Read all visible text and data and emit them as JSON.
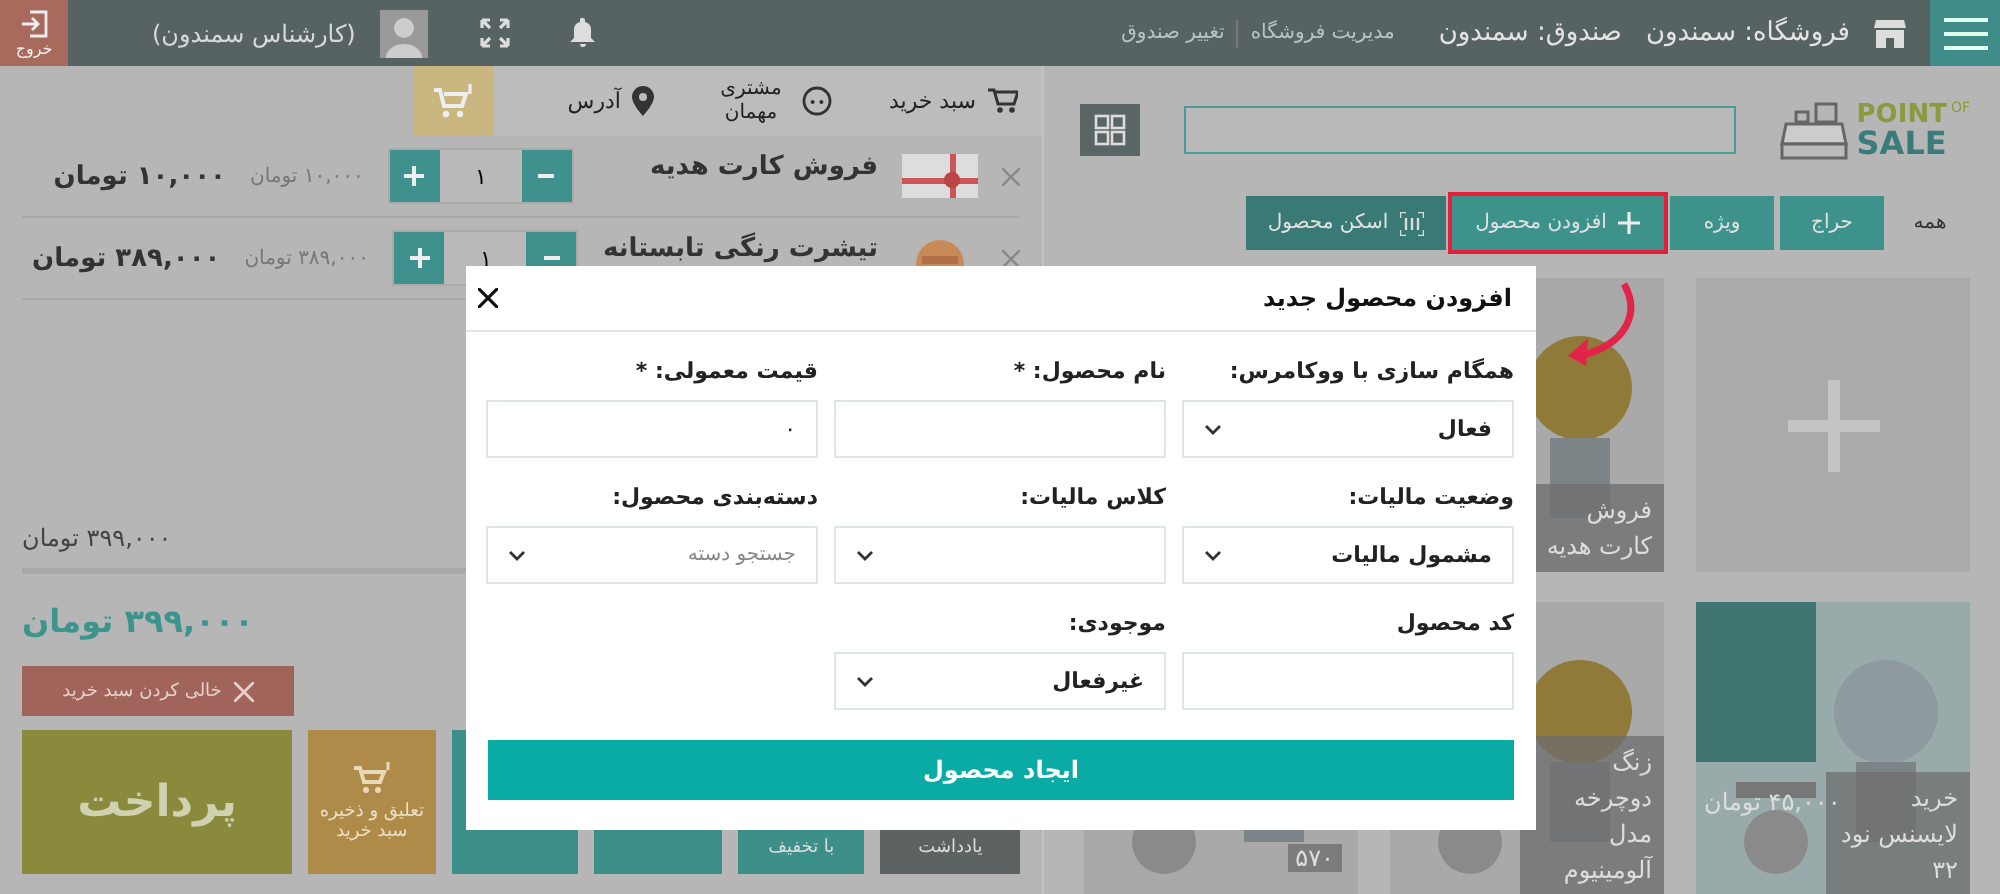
{
  "topbar": {
    "store": "فروشگاه: سمندون",
    "register": "صندوق: سمندون",
    "links": [
      "مدیریت فروشگاه",
      "تغییر صندوق"
    ],
    "user": "(کارشناس سمندون)",
    "exit": "خروج"
  },
  "cart": {
    "title": "سبد خرید",
    "customer": "مشتری مهمان",
    "address": "آدرس",
    "items": [
      {
        "name": "فروش کارت هدیه",
        "qty": "۱",
        "unit_price": "۱۰,۰۰۰ تومان",
        "total": "۱۰,۰۰۰ تومان"
      },
      {
        "name": "تیشرت رنگی تابستانه",
        "qty": "۱",
        "unit_price": "۳۸۹,۰۰۰ تومان",
        "total": "۳۸۹,۰۰۰ تومان"
      }
    ],
    "subtotal": "۳۹۹,۰۰۰ تومان",
    "total": "۳۹۹,۰۰۰ تومان",
    "clear": "خالی کردن سبد خرید",
    "actions": [
      {
        "kind": "pay",
        "label": "پرداخت"
      },
      {
        "kind": "suspend",
        "label": "تعلیق و ذخیره سبد خرید"
      },
      {
        "kind": "teal"
      },
      {
        "kind": "teal"
      },
      {
        "kind": "teal",
        "label": "با تخفیف"
      },
      {
        "kind": "note",
        "label": "یادداشت"
      }
    ]
  },
  "products": {
    "logo": {
      "line1": "POINT",
      "small": "OF",
      "line2": "SALE"
    },
    "tabs": [
      {
        "label": "همه",
        "kind": "category",
        "selected": true,
        "highlighted": false
      },
      {
        "label": "حراج",
        "kind": "category",
        "selected": false,
        "highlighted": false
      },
      {
        "label": "ویژه",
        "kind": "category",
        "selected": false,
        "highlighted": false
      },
      {
        "label": "افزودن محصول",
        "kind": "add",
        "selected": false,
        "highlighted": true
      },
      {
        "label": "اسکن محصول",
        "kind": "scan",
        "selected": false,
        "highlighted": false
      }
    ],
    "rows": [
      [
        {
          "kind": "add"
        },
        {
          "kind": "product",
          "name": "فروش کارت هدیه"
        }
      ],
      [
        {
          "kind": "product",
          "name": "خرید لایسنس نود ۳۲",
          "price": "۴۵,۰۰۰ تومان"
        },
        {
          "kind": "product",
          "name": "زنگ دوچرخه مدل آلومینیوم"
        },
        {
          "kind": "product",
          "price": "۵۷۰"
        }
      ]
    ]
  },
  "modal": {
    "title": "افزودن محصول جدید",
    "fields": [
      {
        "label": "همگام سازی با ووکامرس:",
        "kind": "select",
        "value": "فعال"
      },
      {
        "label": "نام محصول: *",
        "kind": "input"
      },
      {
        "label": "قیمت معمولی: *",
        "kind": "input",
        "value": "۰"
      },
      {
        "label": "وضعیت مالیات:",
        "kind": "select",
        "value": "مشمول مالیات"
      },
      {
        "label": "کلاس مالیات:",
        "kind": "select"
      },
      {
        "label": "دسته‌بندی محصول:",
        "kind": "select",
        "placeholder": "جستجو دسته"
      },
      {
        "label": "کد محصول",
        "kind": "input"
      },
      {
        "label": "موجودی:",
        "kind": "select",
        "value": "غیرفعال"
      }
    ],
    "submit": "ایجاد محصول"
  }
}
